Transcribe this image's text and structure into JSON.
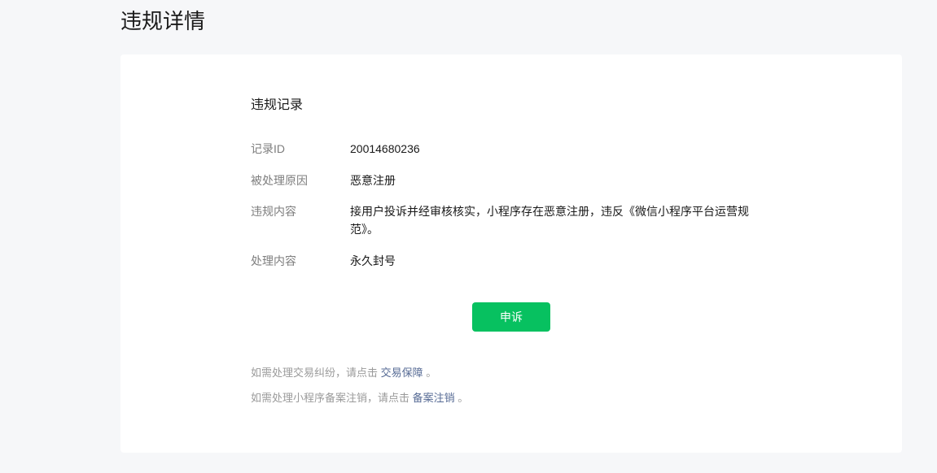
{
  "page": {
    "title": "违规详情"
  },
  "record": {
    "section_title": "违规记录",
    "rows": [
      {
        "label": "记录ID",
        "value": "20014680236"
      },
      {
        "label": "被处理原因",
        "value": "恶意注册"
      },
      {
        "label": "违规内容",
        "value": "接用户投诉并经审核核实，小程序存在恶意注册，违反《微信小程序平台运营规范》。"
      },
      {
        "label": "处理内容",
        "value": "永久封号"
      }
    ]
  },
  "actions": {
    "appeal_label": "申诉"
  },
  "notes": [
    {
      "prefix": "如需处理交易纠纷，请点击 ",
      "link": "交易保障",
      "suffix": " 。"
    },
    {
      "prefix": "如需处理小程序备案注销，请点击 ",
      "link": "备案注销",
      "suffix": " 。"
    }
  ],
  "colors": {
    "accent": "#07c160",
    "link": "#576b95",
    "label": "#7e7e7e",
    "muted": "#9a9a9a"
  }
}
